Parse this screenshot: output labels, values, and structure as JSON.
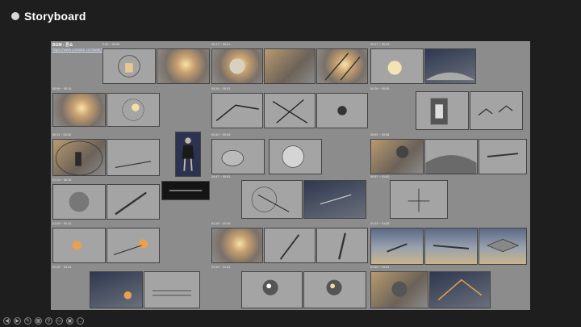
{
  "slide": {
    "title": "Storyboard"
  },
  "board": {
    "bgm_label": "BGM : 폰소",
    "bgm_url": "https://www.youtube.com/watch?v=...",
    "timecodes": [
      "0:00 ~ 00:05",
      "00:17 ~ 00:21",
      "00:27 ~ 00:29",
      "00:06 ~ 00:10",
      "00:16 ~ 00:21",
      "00:26 ~ 00:30",
      "00:11 ~ 00:15",
      "00:40 ~ 00:45",
      "00:52 ~ 00:56",
      "01:16 ~ 00:16",
      "00:47 ~ 00:51",
      "00:57 ~ 01:00",
      "01:03 ~ 01:12",
      "01:15 ~ 01:19",
      "01:23 ~ 01:25",
      "01:20 ~ 01:24",
      "01:32 ~ 01:33",
      "01:30 ~ 01:31"
    ]
  },
  "toolbar": {
    "buttons": [
      {
        "name": "previous-slide-button",
        "glyph": "◀"
      },
      {
        "name": "next-slide-button",
        "glyph": "▶"
      },
      {
        "name": "pen-tool-button",
        "glyph": "✎"
      },
      {
        "name": "slides-grid-button",
        "glyph": "▦"
      },
      {
        "name": "zoom-button",
        "glyph": "⚲"
      },
      {
        "name": "subtitles-button",
        "glyph": "▭"
      },
      {
        "name": "camera-button",
        "glyph": "▣"
      },
      {
        "name": "more-options-button",
        "glyph": "…"
      }
    ]
  }
}
